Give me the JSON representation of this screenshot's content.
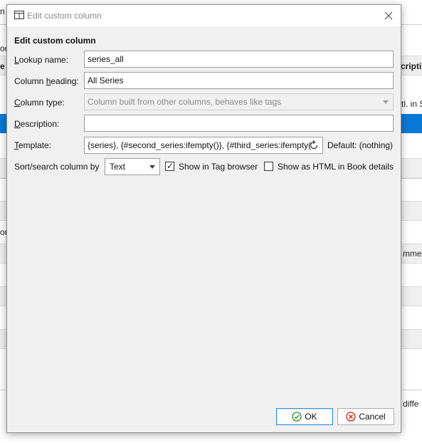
{
  "background": {
    "fragments": [
      "n",
      "oc",
      "e",
      "cripti",
      "tl. in S",
      "on",
      "mmel",
      "diffe"
    ]
  },
  "dialog": {
    "title": "Edit custom column",
    "heading": "Edit custom column",
    "fields": {
      "lookup_name": {
        "label_pre": "",
        "label_key": "L",
        "label_post": "ookup name:",
        "value": "series_all"
      },
      "column_heading": {
        "label_pre": "Column ",
        "label_key": "h",
        "label_post": "eading:",
        "value": "All Series"
      },
      "column_type": {
        "label_pre": "",
        "label_key": "C",
        "label_post": "olumn type:",
        "value": "Column built from other columns, behaves like tags"
      },
      "description": {
        "label_pre": "",
        "label_key": "D",
        "label_post": "escription:",
        "value": ""
      },
      "template": {
        "label_pre": "",
        "label_key": "T",
        "label_post": "emplate:",
        "value": "{series}, {#second_series:ifempty()}, {#third_series:ifempty(",
        "default_text": "Default: (nothing)"
      }
    },
    "sort_search": {
      "label": "Sort/search column by",
      "selected": "Text",
      "show_in_tag_browser": {
        "label": "Show in Tag browser",
        "checked": true
      },
      "show_as_html": {
        "label": "Show as HTML in Book details",
        "checked": false
      }
    },
    "buttons": {
      "ok": "OK",
      "cancel": "Cancel"
    },
    "colors": {
      "accent": "#0a78d7",
      "cancel_red": "#c42b1c",
      "ok_green": "#2d8a2d"
    }
  }
}
